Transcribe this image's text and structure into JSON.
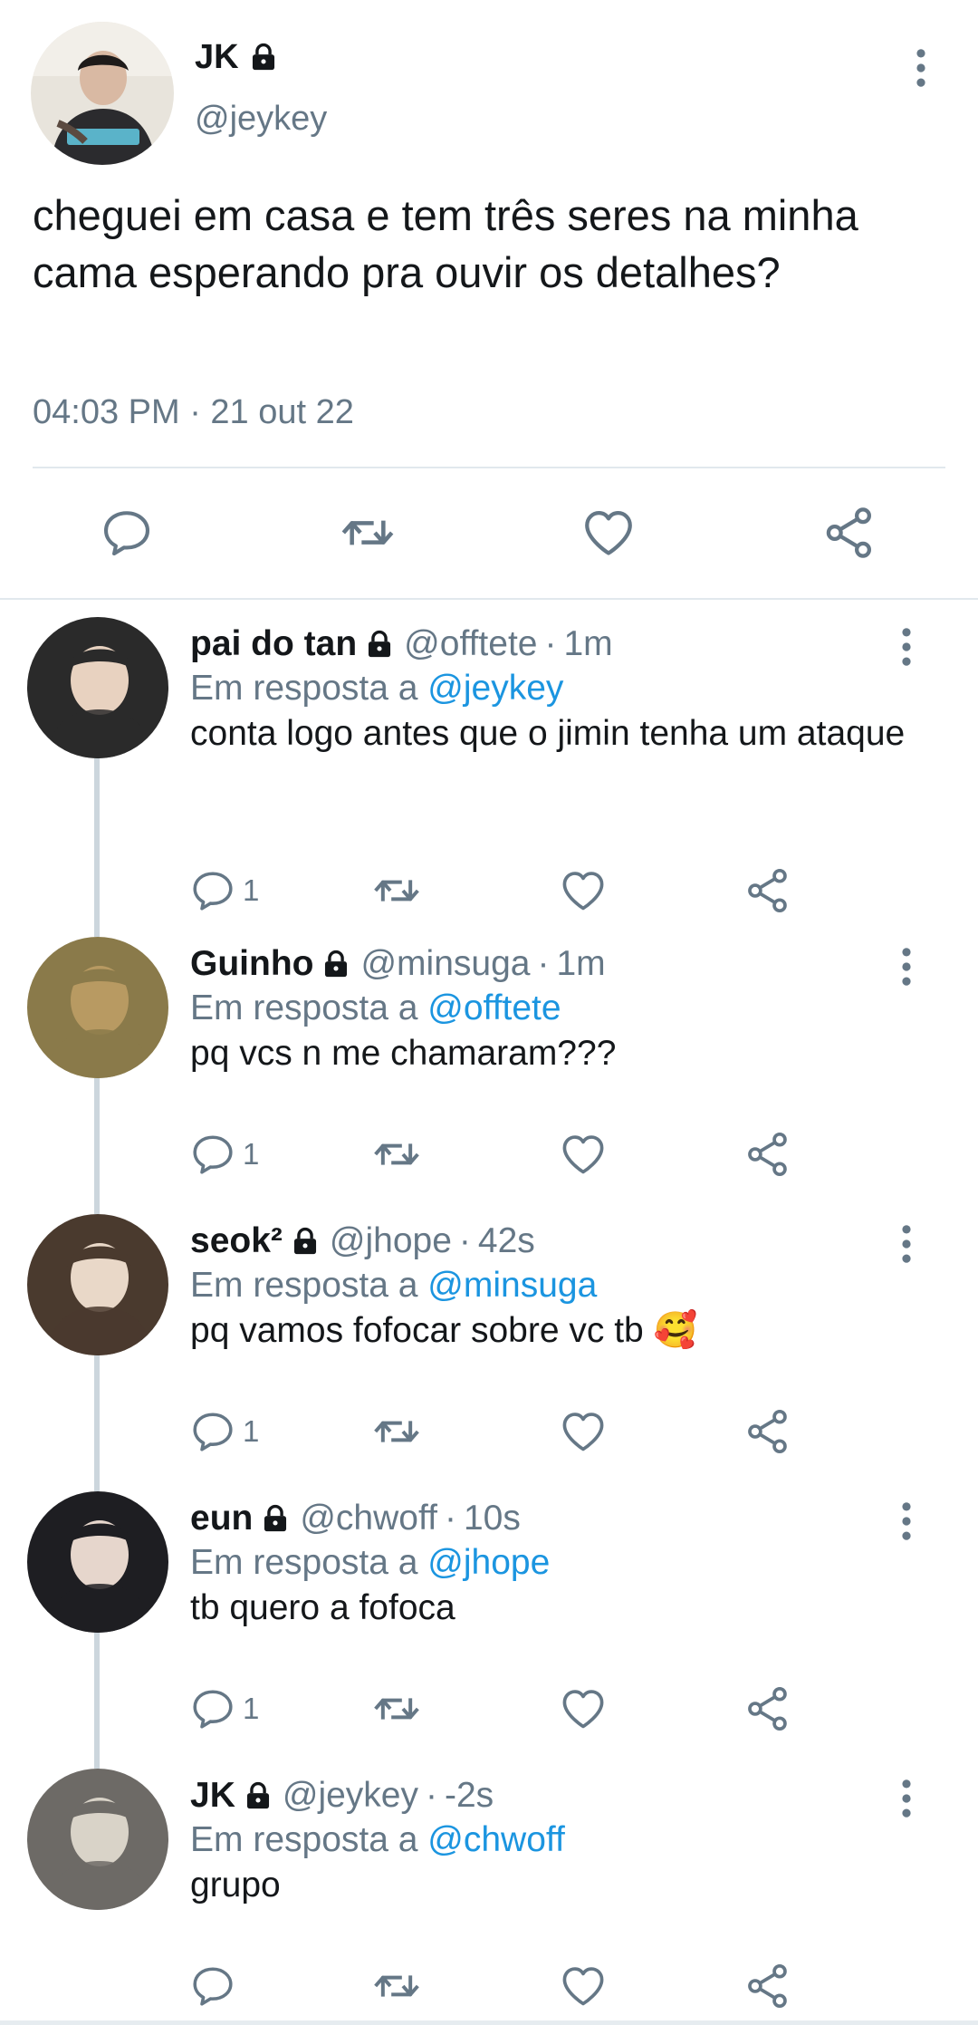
{
  "main_tweet": {
    "name": "JK",
    "handle": "@jeykey",
    "text": "cheguei em casa e tem três seres na minha cama esperando pra ouvir os detalhes?",
    "time": "04:03 PM · 21 out 22"
  },
  "replying_prefix": "Em resposta a ",
  "replies": [
    {
      "name": "pai do tan",
      "handle": "@offtete",
      "time": "1m",
      "replying_to": "@jeykey",
      "text": "conta logo antes que o jimin tenha um ataque",
      "reply_count": "1",
      "avatar_colors": [
        "#2a2a2a",
        "#e8d2c0"
      ]
    },
    {
      "name": "Guinho",
      "handle": "@minsuga",
      "time": "1m",
      "replying_to": "@offtete",
      "text": "pq vcs n me chamaram???",
      "reply_count": "1",
      "avatar_colors": [
        "#8a7a4a",
        "#b89a62"
      ]
    },
    {
      "name": "seok²",
      "handle": "@jhope",
      "time": "42s",
      "replying_to": "@minsuga",
      "text": "pq vamos fofocar sobre vc tb 🥰",
      "reply_count": "1",
      "avatar_colors": [
        "#4a3a2e",
        "#e9d8c8"
      ]
    },
    {
      "name": "eun",
      "handle": "@chwoff",
      "time": "10s",
      "replying_to": "@jhope",
      "text": "tb quero a fofoca",
      "reply_count": "1",
      "avatar_colors": [
        "#1e1e22",
        "#e6d6cc"
      ]
    },
    {
      "name": "JK",
      "handle": "@jeykey",
      "time": "-2s",
      "replying_to": "@chwoff",
      "text": "grupo",
      "reply_count": "",
      "avatar_colors": [
        "#6d6a66",
        "#d9d3c8"
      ]
    }
  ],
  "colors": {
    "text": "#14171a",
    "muted": "#657786",
    "link": "#1b95e0",
    "icon": "#657786",
    "separator": "#e1e8ed"
  },
  "icons": [
    "lock-icon",
    "more-icon",
    "reply-icon",
    "retweet-icon",
    "like-icon",
    "share-icon"
  ]
}
